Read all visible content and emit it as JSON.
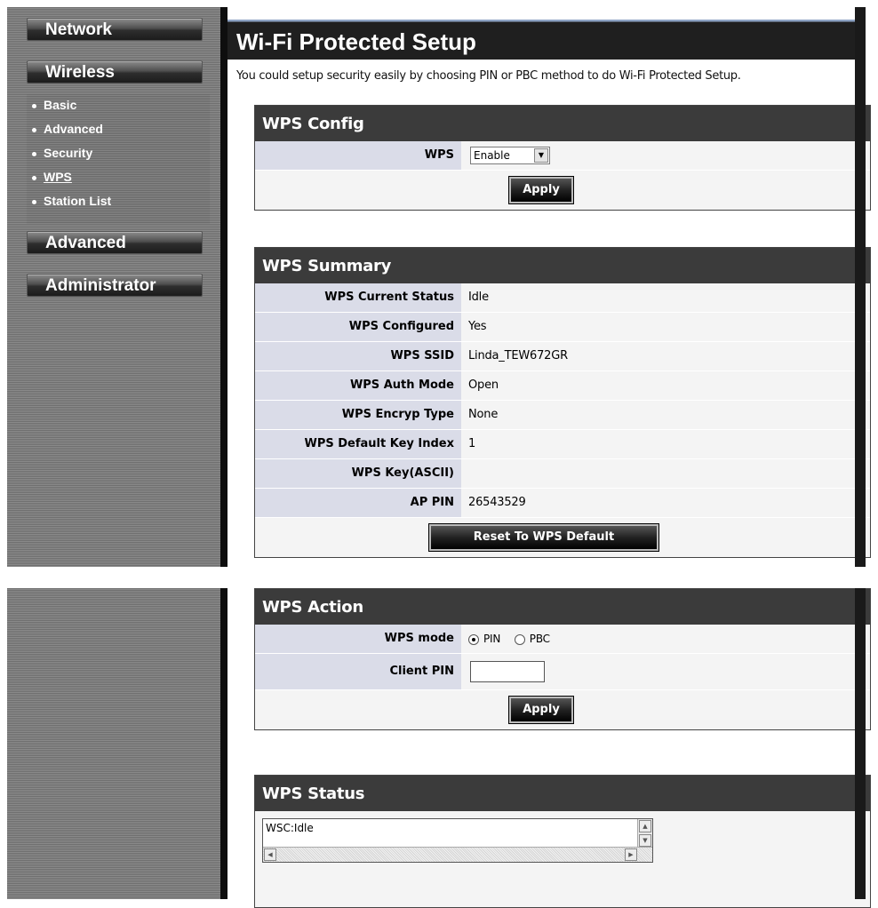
{
  "sidebar": {
    "network": "Network",
    "wireless": "Wireless",
    "submenu": [
      "Basic",
      "Advanced",
      "Security",
      "WPS",
      "Station List"
    ],
    "advanced": "Advanced",
    "administrator": "Administrator"
  },
  "page": {
    "title": "Wi-Fi Protected Setup",
    "intro": "You could setup security easily by choosing PIN or PBC method to do Wi-Fi Protected Setup."
  },
  "config": {
    "header": "WPS Config",
    "wps_label": "WPS",
    "wps_value": "Enable",
    "apply": "Apply"
  },
  "summary": {
    "header": "WPS Summary",
    "rows": [
      {
        "label": "WPS Current Status",
        "value": "Idle"
      },
      {
        "label": "WPS Configured",
        "value": "Yes"
      },
      {
        "label": "WPS SSID",
        "value": "Linda_TEW672GR"
      },
      {
        "label": "WPS Auth Mode",
        "value": "Open"
      },
      {
        "label": "WPS Encryp Type",
        "value": "None"
      },
      {
        "label": "WPS Default Key Index",
        "value": "1"
      },
      {
        "label": "WPS Key(ASCII)",
        "value": ""
      },
      {
        "label": "AP PIN",
        "value": "26543529"
      }
    ],
    "reset": "Reset To WPS Default"
  },
  "action": {
    "header": "WPS Action",
    "mode_label": "WPS mode",
    "pin": "PIN",
    "pbc": "PBC",
    "client_pin_label": "Client PIN",
    "client_pin_value": "",
    "apply": "Apply"
  },
  "status": {
    "header": "WPS Status",
    "text": "WSC:Idle"
  }
}
